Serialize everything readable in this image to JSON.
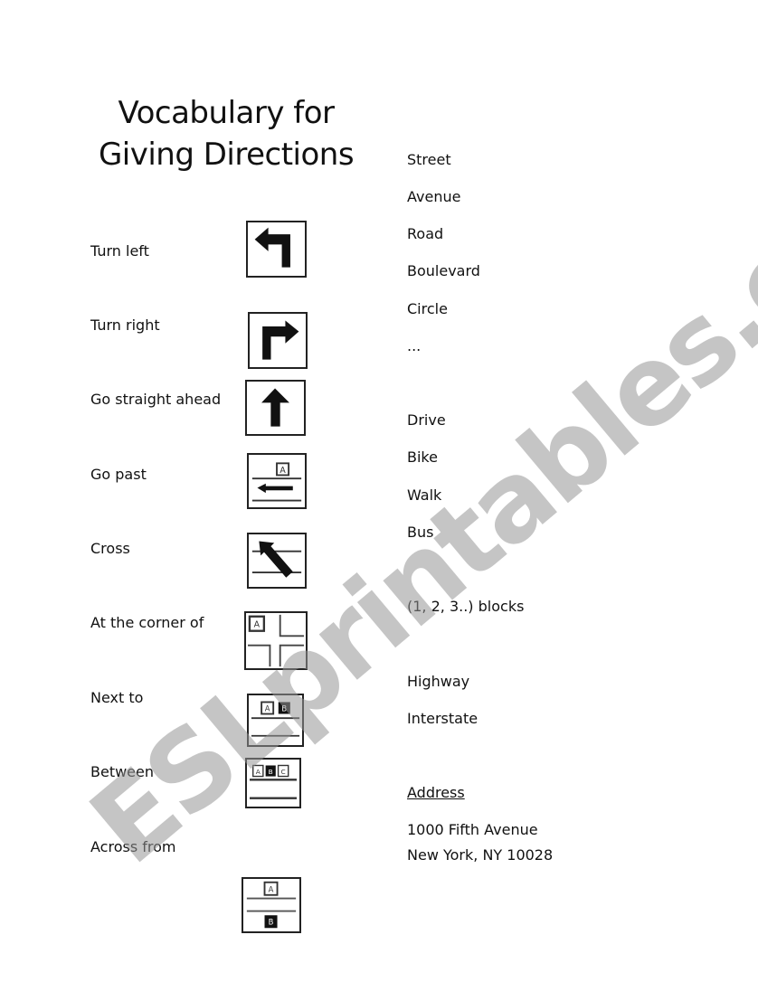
{
  "title": {
    "line1": "Vocabulary for",
    "line2": "Giving Directions"
  },
  "directions": [
    {
      "label": "Turn left",
      "icon": "turn-left-arrow-icon"
    },
    {
      "label": "Turn right",
      "icon": "turn-right-arrow-icon"
    },
    {
      "label": "Go straight ahead",
      "icon": "straight-arrow-icon"
    },
    {
      "label": "Go past",
      "icon": "go-past-icon"
    },
    {
      "label": "Cross",
      "icon": "cross-street-icon"
    },
    {
      "label": "At the corner of",
      "icon": "corner-intersection-icon"
    },
    {
      "label": "Next to",
      "icon": "next-to-icon"
    },
    {
      "label": "Between",
      "icon": "between-icon"
    },
    {
      "label": "Across from",
      "icon": "across-from-icon"
    }
  ],
  "icon_letters": {
    "a": "A",
    "b": "B",
    "c": "C"
  },
  "right_column": {
    "streets": [
      "Street",
      "Avenue",
      "Road",
      "Boulevard",
      "Circle",
      "..."
    ],
    "transport": [
      "Drive",
      "Bike",
      "Walk",
      "Bus"
    ],
    "blocks": "(1, 2, 3..) blocks",
    "roads": [
      "Highway",
      "Interstate"
    ],
    "address_heading": "Address",
    "address_line1": "1000 Fifth Avenue",
    "address_line2": "New York, NY 10028"
  },
  "watermark": "ESLprintables.com"
}
